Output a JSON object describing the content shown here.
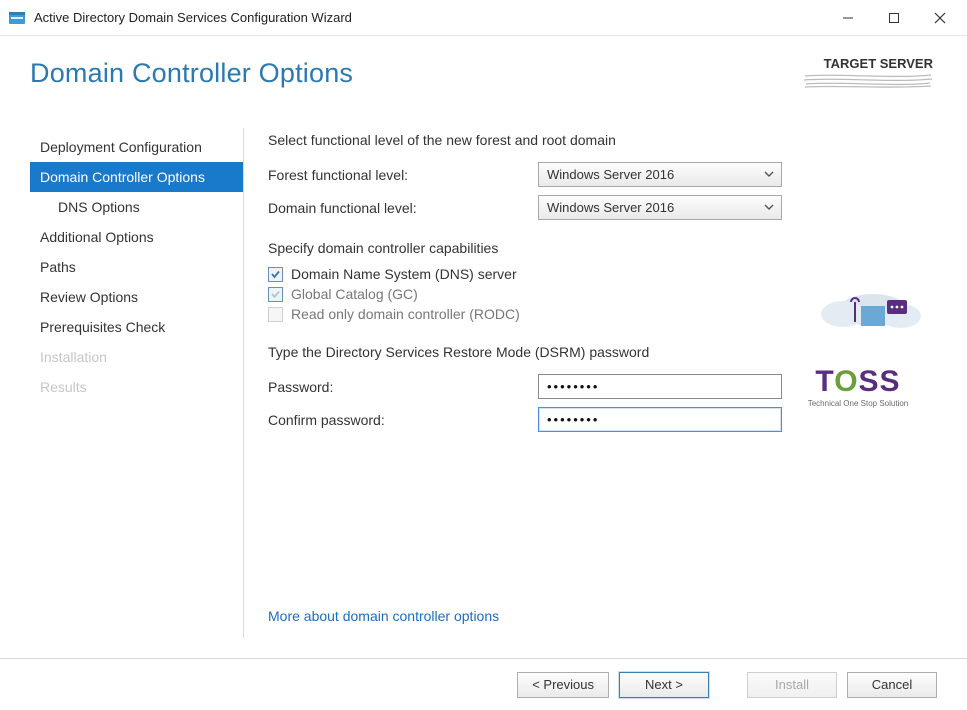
{
  "window": {
    "title": "Active Directory Domain Services Configuration Wizard"
  },
  "header": {
    "page_title": "Domain Controller Options",
    "target_label": "TARGET SERVER"
  },
  "sidebar": {
    "items": [
      {
        "label": "Deployment Configuration",
        "indent": false,
        "active": false,
        "enabled": true
      },
      {
        "label": "Domain Controller Options",
        "indent": false,
        "active": true,
        "enabled": true
      },
      {
        "label": "DNS Options",
        "indent": true,
        "active": false,
        "enabled": true
      },
      {
        "label": "Additional Options",
        "indent": false,
        "active": false,
        "enabled": true
      },
      {
        "label": "Paths",
        "indent": false,
        "active": false,
        "enabled": true
      },
      {
        "label": "Review Options",
        "indent": false,
        "active": false,
        "enabled": true
      },
      {
        "label": "Prerequisites Check",
        "indent": false,
        "active": false,
        "enabled": true
      },
      {
        "label": "Installation",
        "indent": false,
        "active": false,
        "enabled": false
      },
      {
        "label": "Results",
        "indent": false,
        "active": false,
        "enabled": false
      }
    ]
  },
  "content": {
    "functional_heading": "Select functional level of the new forest and root domain",
    "forest_label": "Forest functional level:",
    "forest_value": "Windows Server 2016",
    "domain_label": "Domain functional level:",
    "domain_value": "Windows Server 2016",
    "capabilities_heading": "Specify domain controller capabilities",
    "cap_dns": "Domain Name System (DNS) server",
    "cap_gc": "Global Catalog (GC)",
    "cap_rodc": "Read only domain controller (RODC)",
    "dsrm_heading": "Type the Directory Services Restore Mode (DSRM) password",
    "password_label": "Password:",
    "password_value": "••••••••",
    "confirm_label": "Confirm password:",
    "confirm_value": "••••••••",
    "more_link": "More about domain controller options"
  },
  "watermark": {
    "brand": "TOSS",
    "tagline": "Technical One Stop Solution"
  },
  "footer": {
    "previous": "< Previous",
    "next": "Next >",
    "install": "Install",
    "cancel": "Cancel"
  }
}
